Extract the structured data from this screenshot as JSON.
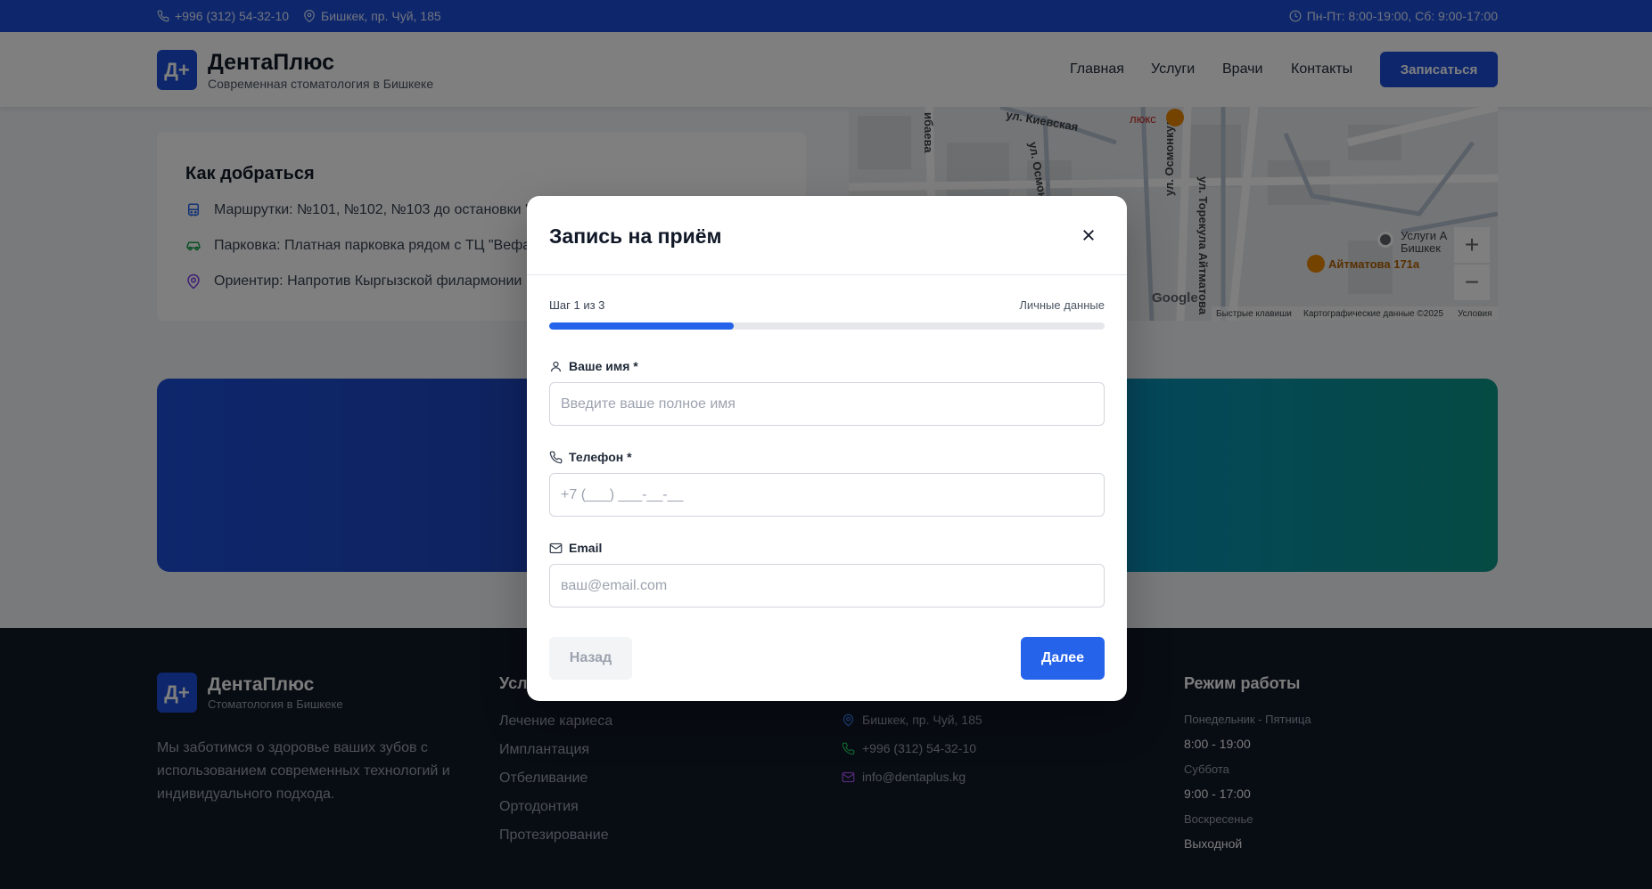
{
  "topbar": {
    "phone": "+996 (312) 54-32-10",
    "address": "Бишкек, пр. Чуй, 185",
    "hours": "Пн-Пт: 8:00-19:00, Сб: 9:00-17:00"
  },
  "header": {
    "logo": "Д+",
    "brand": "ДентаПлюс",
    "tagline": "Современная стоматология в Бишкеке",
    "nav": [
      "Главная",
      "Услуги",
      "Врачи",
      "Контакты"
    ],
    "cta": "Записаться"
  },
  "directions": {
    "title": "Как добраться",
    "items": [
      {
        "icon": "bus-icon",
        "text": "Маршрутки: №101, №102, №103 до остановки \"",
        "color": "#2563eb"
      },
      {
        "icon": "car-icon",
        "text": "Парковка: Платная парковка рядом с ТЦ \"Вефа\"",
        "color": "#16a34a"
      },
      {
        "icon": "map-pin-icon",
        "text": "Ориентир: Напротив Кыргызской филармонии",
        "color": "#7c3aed"
      }
    ]
  },
  "map": {
    "streets": [
      "ул. Киевская",
      "ул. Осмонкула",
      "ул. Торекула Айтматова",
      "ибаева",
      "ул. Осмон",
      "ул. Т"
    ],
    "places": [
      "люкс",
      "Айтматова 171а",
      "Услуги А",
      "Бишкек"
    ],
    "footer": [
      "Быстрые клавиши",
      "Картографические данные ©2025",
      "Условия"
    ],
    "brand": "Google",
    "zoom_in": "+",
    "zoom_out": "−"
  },
  "footer": {
    "logo": "Д+",
    "brand": "ДентаПлюс",
    "tagline": "Стоматология в Бишкеке",
    "description": "Мы заботимся о здоровье ваших зубов с использованием современных технологий и индивидуального подхода.",
    "services_title": "Услу",
    "services": [
      "Лечение кариеса",
      "Имплантация",
      "Отбеливание",
      "Ортодонтия",
      "Протезирование"
    ],
    "contacts": [
      {
        "icon": "map-pin-icon",
        "text": "Бишкек, пр. Чуй, 185",
        "color": "#3b82f6"
      },
      {
        "icon": "phone-icon",
        "text": "+996 (312) 54-32-10",
        "color": "#22c55e"
      },
      {
        "icon": "mail-icon",
        "text": "info@dentaplus.kg",
        "color": "#a855f7"
      }
    ],
    "hours_title": "Режим работы",
    "hours": [
      {
        "label": "Понедельник - Пятница",
        "value": "8:00 - 19:00"
      },
      {
        "label": "Суббота",
        "value": "9:00 - 17:00"
      },
      {
        "label": "Воскресенье",
        "value": "Выходной"
      }
    ]
  },
  "modal": {
    "title": "Запись на приём",
    "step": "Шаг 1 из 3",
    "step_name": "Личные данные",
    "progress": 0.333,
    "fields": {
      "name": {
        "label": "Ваше имя *",
        "placeholder": "Введите ваше полное имя",
        "value": ""
      },
      "phone": {
        "label": "Телефон *",
        "placeholder": "+7 (___) ___-__-__",
        "value": ""
      },
      "email": {
        "label": "Email",
        "placeholder": "ваш@email.com",
        "value": ""
      }
    },
    "back": "Назад",
    "next": "Далее"
  },
  "colors": {
    "primary": "#1d4ed8",
    "button": "#2563eb",
    "footer_bg": "#111827"
  }
}
